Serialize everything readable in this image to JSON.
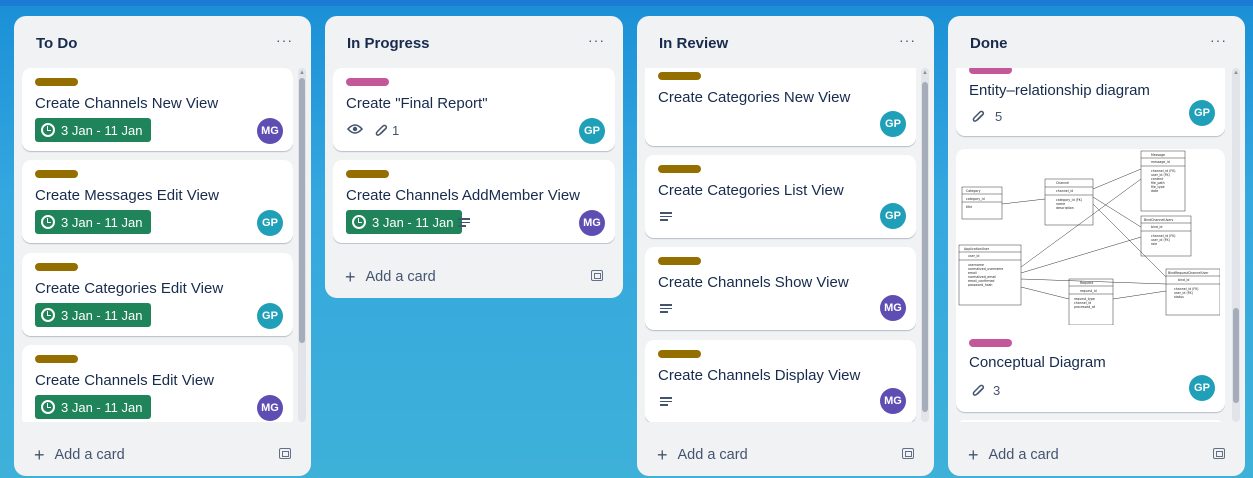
{
  "lists": [
    {
      "title": "To Do",
      "menu": "···",
      "add_card": "Add a card",
      "cards": [
        {
          "label_color": "olive",
          "title": "Create Channels New View",
          "due": "3 Jan - 11 Jan",
          "member": "MG"
        },
        {
          "label_color": "olive",
          "title": "Create Messages Edit View",
          "due": "3 Jan - 11 Jan",
          "member": "GP"
        },
        {
          "label_color": "olive",
          "title": "Create Categories Edit View",
          "due": "3 Jan - 11 Jan",
          "member": "GP"
        },
        {
          "label_color": "olive",
          "title": "Create Channels Edit View",
          "due": "3 Jan - 11 Jan",
          "member": "MG"
        }
      ]
    },
    {
      "title": "In Progress",
      "menu": "···",
      "add_card": "Add a card",
      "cards": [
        {
          "label_color": "magenta",
          "title": "Create \"Final Report\"",
          "attachments": "1",
          "member": "GP"
        },
        {
          "label_color": "olive",
          "title": "Create Channels AddMember View",
          "due": "3 Jan - 11 Jan",
          "member": "MG"
        }
      ]
    },
    {
      "title": "In Review",
      "menu": "···",
      "add_card": "Add a card",
      "cards": [
        {
          "label_color": "olive",
          "title": "Create Categories New View",
          "member": "GP"
        },
        {
          "label_color": "olive",
          "title": "Create Categories List View",
          "member": "GP"
        },
        {
          "label_color": "olive",
          "title": "Create Channels Show View",
          "member": "MG"
        },
        {
          "label_color": "olive",
          "title": "Create Channels Display View",
          "member": "MG"
        }
      ]
    },
    {
      "title": "Done",
      "menu": "···",
      "add_card": "Add a card",
      "cards": [
        {
          "label_color": "magenta",
          "title": "Entity–relationship diagram",
          "attachments": "5",
          "member": "GP"
        },
        {
          "label_color": "magenta",
          "title": "Conceptual Diagram",
          "attachments": "3",
          "member": "GP"
        }
      ]
    }
  ],
  "diagram_text": {
    "category": "Category",
    "category_pk": "category_id",
    "category_f": "title",
    "channel": "Channel",
    "channel_pk": "channel_id",
    "channel_f": "category_id (FK)\nname\ndescription",
    "message": "Message",
    "message_pk": "message_id",
    "message_f": "channel_id (FK)\nuser_id (FK)\ncontent\nfile_path\nfile_type\ndate",
    "bind": "BindChannelUsers",
    "bind_pk": "bind_id",
    "bind_f": "channel_id (FK)\nuser_id (FK)\nrole",
    "app": "ApplicationUser",
    "app_pk": "user_id",
    "app_f": "username\nnormalized_username\nemail\nnormalized_email\nemail_confirmed\npassword_hash",
    "request": "Request",
    "request_pk": "request_id",
    "request_f": "request_type\nchannel_id\nprocessed_at",
    "bindreq": "BindRequestChannelUser",
    "bindreq_pk": "bind_id",
    "bindreq_f": "channel_id (FK)\nuser_id (FK)\nstatus"
  },
  "colors": {
    "board_bg": "#1a8fd6",
    "list_bg": "#f1f2f4",
    "label_olive": "#946f00",
    "label_magenta": "#c3579a",
    "due_green": "#1f845a",
    "avatar_mg": "#5e4db2",
    "avatar_gp": "#1fa0b8"
  },
  "icons": {
    "due": "clock-icon",
    "watch": "eye-icon",
    "attachment": "paperclip-icon",
    "description": "description-icon",
    "add": "plus-icon",
    "template": "card-template-icon",
    "menu": "more-icon"
  }
}
